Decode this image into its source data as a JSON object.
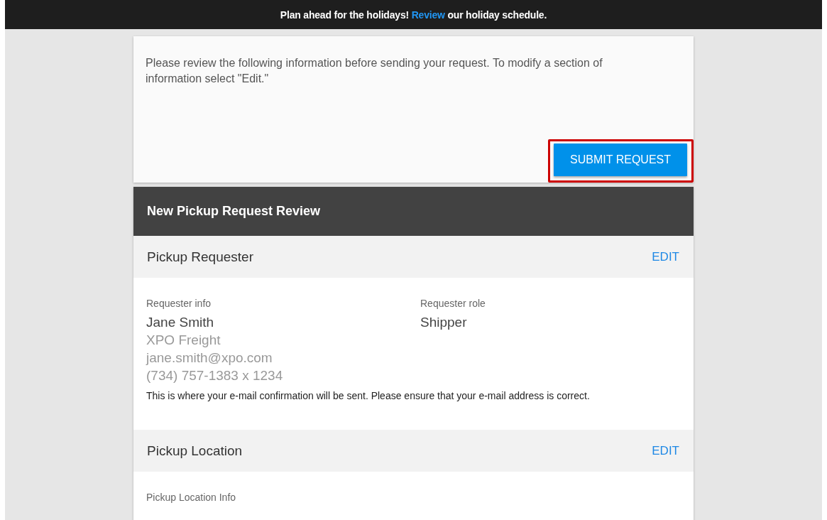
{
  "banner": {
    "before": "Plan ahead for the holidays!",
    "link": "Review",
    "after": "our holiday schedule."
  },
  "intro": {
    "text": "Please review the following information before sending your request. To modify a section of information select \"Edit.\"",
    "button": {
      "label": "SUBMIT REQUEST",
      "highlighted": true
    }
  },
  "review": {
    "title": "New Pickup Request Review",
    "sections": [
      {
        "title": "Pickup Requester",
        "action": "EDIT",
        "fields": [
          {
            "label": "Requester info",
            "lines": [
              "Jane Smith",
              "XPO Freight",
              "jane.smith@xpo.com",
              "(734) 757-1383 x 1234"
            ]
          },
          {
            "label": "Requester role",
            "lines": [
              "Shipper"
            ]
          }
        ],
        "note": "This is where your e-mail confirmation will be sent. Please ensure that your e-mail address is correct."
      },
      {
        "title": "Pickup Location",
        "action": "EDIT",
        "fields": [
          {
            "label": "Pickup Location Info"
          }
        ]
      }
    ]
  }
}
